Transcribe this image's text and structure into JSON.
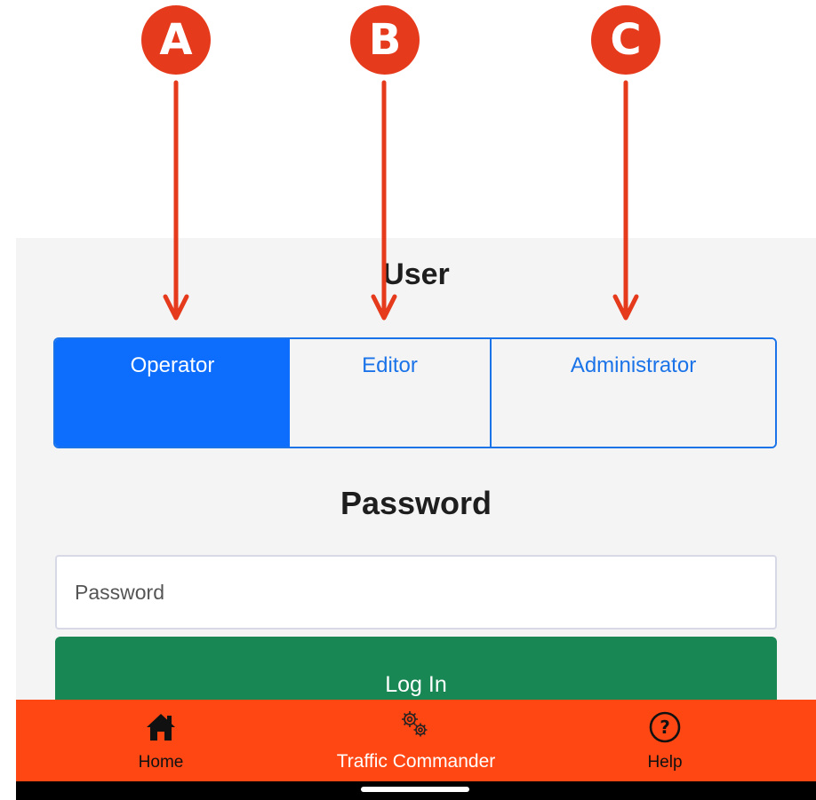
{
  "annotations": {
    "badges": [
      "A",
      "B",
      "C"
    ],
    "color": "#e63a1c"
  },
  "login": {
    "user_title": "User",
    "roles": [
      {
        "label": "Operator",
        "selected": true
      },
      {
        "label": "Editor",
        "selected": false
      },
      {
        "label": "Administrator",
        "selected": false
      }
    ],
    "password_title": "Password",
    "password_placeholder": "Password",
    "password_value": "",
    "login_button": "Log In"
  },
  "bottom_nav": {
    "background": "#ff4713",
    "items": [
      {
        "label": "Home",
        "icon": "home-icon"
      },
      {
        "label": "Traffic Commander",
        "icon": "gears-icon"
      },
      {
        "label": "Help",
        "icon": "help-icon"
      }
    ]
  },
  "colors": {
    "selected_role": "#0d6efd",
    "accent": "#1a73e8",
    "login_button": "#198754"
  }
}
